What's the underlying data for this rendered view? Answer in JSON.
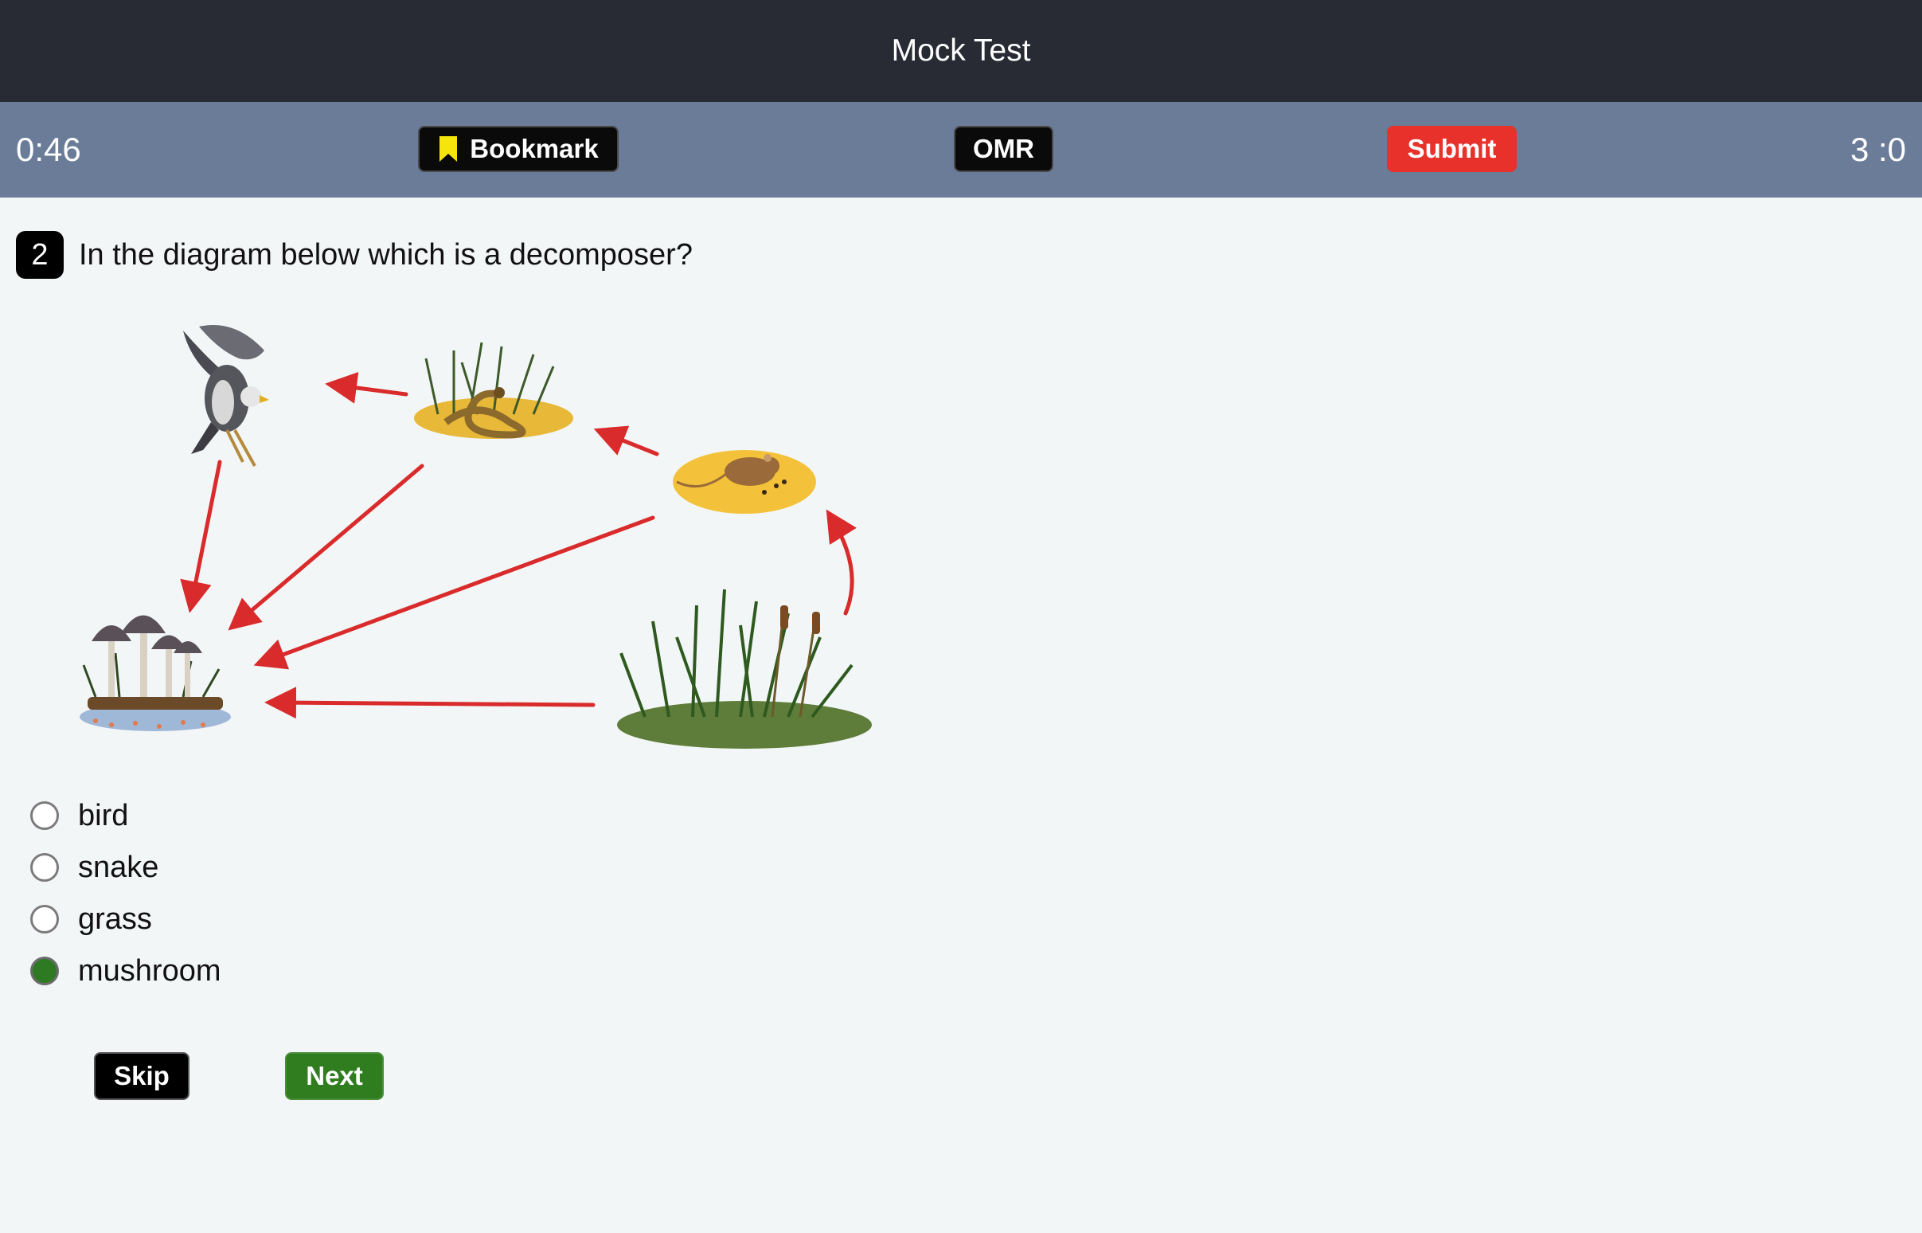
{
  "header": {
    "title": "Mock Test"
  },
  "toolbar": {
    "timer": "0:46",
    "bookmark_label": "Bookmark",
    "bookmark_icon": "bookmark-icon",
    "omr_label": "OMR",
    "submit_label": "Submit",
    "score": "3 :0",
    "colors": {
      "bookmark_icon": "#f5e50a",
      "submit": "#e8312a",
      "bar": "#6a7c98"
    }
  },
  "question": {
    "number": "2",
    "text": "In the diagram below which is a decomposer?",
    "diagram_items": [
      "bird-icon",
      "snake-icon",
      "mouse-icon",
      "grass-icon",
      "mushroom-icon"
    ],
    "options": [
      {
        "label": "bird",
        "selected": false
      },
      {
        "label": "snake",
        "selected": false
      },
      {
        "label": "grass",
        "selected": false
      },
      {
        "label": "mushroom",
        "selected": true
      }
    ]
  },
  "actions": {
    "skip_label": "Skip",
    "next_label": "Next",
    "colors": {
      "next": "#2f7d1f",
      "selected_radio": "#2d7a22"
    }
  }
}
